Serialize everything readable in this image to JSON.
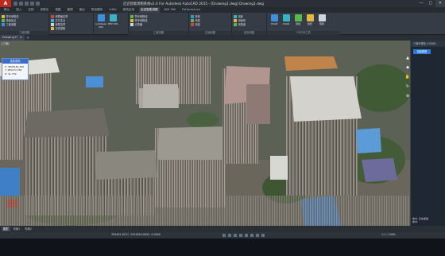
{
  "window": {
    "title": "启迈智能测图系统v2.4 For Autodesk AutoCAD 2015 - [Drawing1.dwg] Drawing1.dwg",
    "controls": [
      "—",
      "□",
      "✕"
    ]
  },
  "ribbon_tabs": [
    "默认",
    "插入",
    "注释",
    "参数化",
    "视图",
    "管理",
    "输出",
    "附加模块",
    "A360",
    "精选应用",
    "启迈智能测图",
    "BIM 360",
    "Performance"
  ],
  "ribbon_active_tab": 10,
  "panels": [
    {
      "name": "三维测图",
      "buttons": [
        "符号地物线",
        "快速加点",
        "三维测图"
      ]
    },
    {
      "name": "",
      "buttons": [
        "房屋面边界",
        "交叉定点",
        "房屋边界",
        "实体提取"
      ]
    },
    {
      "name": "",
      "buttons": [
        "AutoDesk 360",
        "BIM 360",
        "BIM 360"
      ]
    },
    {
      "name": "三维测图",
      "buttons": [
        "符号地物线",
        "符号地物线",
        "计算器",
        "打开地图"
      ]
    },
    {
      "name": "正面测图",
      "buttons": [
        "查看",
        "测量",
        "测量"
      ]
    },
    {
      "name": "坐标测图",
      "buttons": [
        "测距",
        "测面积",
        "测角度"
      ]
    },
    {
      "name": "CSS3D工具",
      "buttons": [
        "OSGB",
        "OSGB",
        "测量",
        "地形",
        "帮助"
      ]
    }
  ],
  "doc_tab": {
    "label": "Drawing1*",
    "close": "×"
  },
  "viewport": {
    "label": "[三维]",
    "info_box": {
      "title": "坐标查询",
      "lines": [
        "X: 3845181.456",
        "Y: 485272.382",
        "Z: 41.759"
      ]
    }
  },
  "nav_icons": [
    "▲",
    "◆",
    "✋",
    "↻",
    "⊕"
  ],
  "dock": {
    "title": "三维可视化 (OSGB)",
    "button": "加载模型",
    "status": [
      "命令: 正在加载",
      "命令: "
    ]
  },
  "layout_tabs": [
    "模型",
    "布局1",
    "布局2"
  ],
  "layout_active": 0,
  "status": {
    "coords": "399481.6227, 3491604.0632, 0.0000",
    "model_label": "模型",
    "zoom": "1:1 / 100%"
  }
}
